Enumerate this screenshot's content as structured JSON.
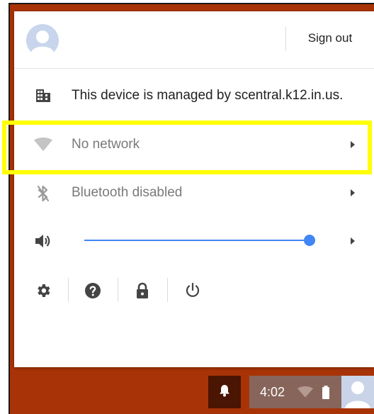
{
  "user_row": {
    "sign_out_label": "Sign out"
  },
  "managed_row": {
    "label": "This device is managed by scentral.k12.in.us."
  },
  "network_row": {
    "label": "No network"
  },
  "bluetooth_row": {
    "label": "Bluetooth disabled"
  },
  "volume_row": {
    "level_percent": 100
  },
  "shelf": {
    "clock": "4:02"
  },
  "colors": {
    "desktop_background": "#a83306",
    "accent": "#4285f4",
    "highlight": "#ffff00",
    "shelf_tray": "#88655a",
    "shelf_notification": "#4a1502"
  },
  "icons": {
    "user": "avatar-icon",
    "managed": "building-icon",
    "network": "wifi-icon",
    "bluetooth": "bluetooth-icon",
    "volume": "speaker-icon",
    "settings": "gear-icon",
    "help": "help-icon",
    "lock": "lock-icon",
    "power": "power-icon",
    "notifications": "bell-icon",
    "battery": "battery-icon"
  }
}
